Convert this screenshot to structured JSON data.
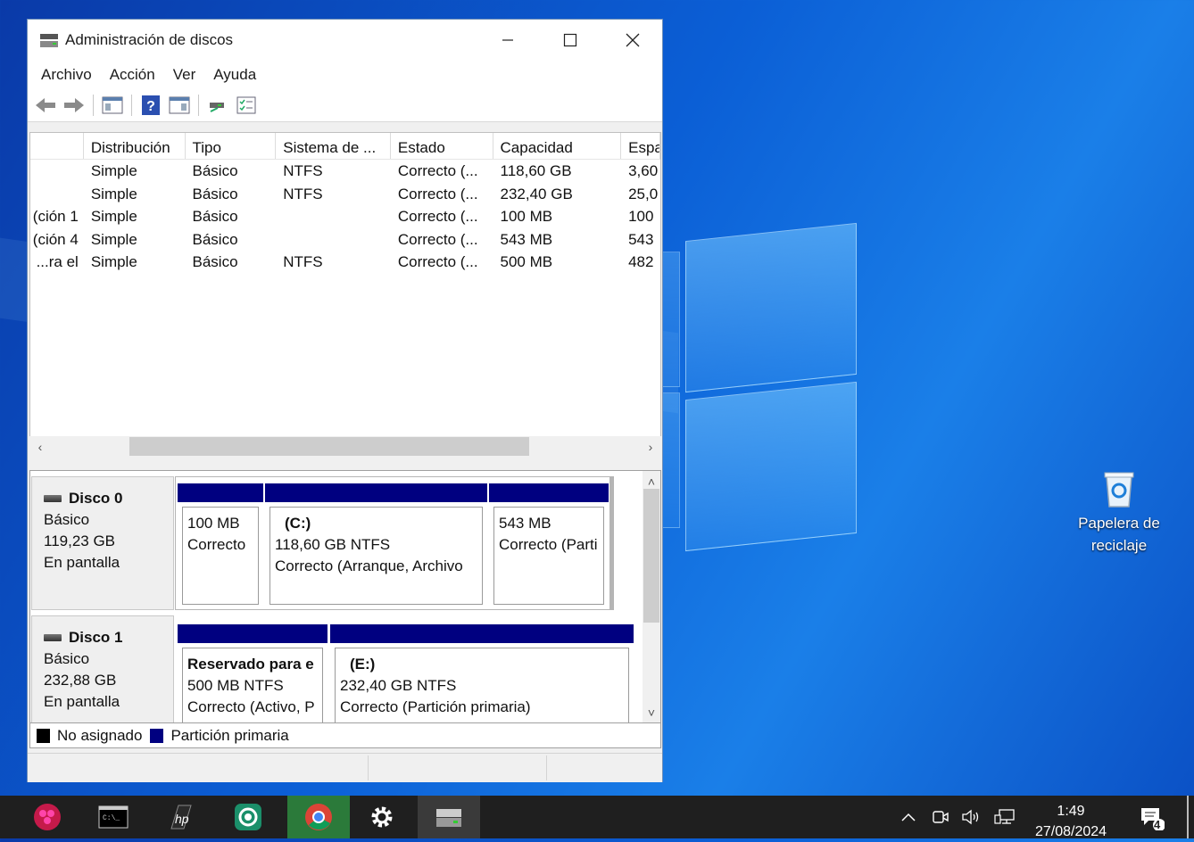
{
  "window": {
    "title": "Administración de discos",
    "menu": [
      "Archivo",
      "Acción",
      "Ver",
      "Ayuda"
    ]
  },
  "volume_list": {
    "columns": [
      "",
      "Distribución",
      "Tipo",
      "Sistema de ...",
      "Estado",
      "Capacidad",
      "Espa"
    ],
    "rows": [
      [
        "",
        "Simple",
        "Básico",
        "NTFS",
        "Correcto (...",
        "118,60 GB",
        "3,60"
      ],
      [
        "",
        "Simple",
        "Básico",
        "NTFS",
        "Correcto (...",
        "232,40 GB",
        "25,0"
      ],
      [
        "ción 1)",
        "Simple",
        "Básico",
        "",
        "Correcto (...",
        "100 MB",
        "100"
      ],
      [
        "ción 4)",
        "Simple",
        "Básico",
        "",
        "Correcto (...",
        "543 MB",
        "543"
      ],
      [
        "ra el...",
        "Simple",
        "Básico",
        "NTFS",
        "Correcto (...",
        "500 MB",
        "482"
      ]
    ]
  },
  "disks": [
    {
      "name": "Disco 0",
      "type": "Básico",
      "size": "119,23 GB",
      "status": "En pantalla",
      "partitions": [
        {
          "label": "",
          "size": "100 MB",
          "status": "Correcto"
        },
        {
          "label": "(C:)",
          "size": "118,60 GB NTFS",
          "status": "Correcto (Arranque, Archivo"
        },
        {
          "label": "",
          "size": "543 MB",
          "status": "Correcto (Parti"
        }
      ]
    },
    {
      "name": "Disco 1",
      "type": "Básico",
      "size": "232,88 GB",
      "status": "En pantalla",
      "partitions": [
        {
          "label": "Reservado para e",
          "size": "500 MB NTFS",
          "status": "Correcto (Activo, P"
        },
        {
          "label": "(E:)",
          "size": "232,40 GB NTFS",
          "status": "Correcto (Partición primaria)"
        }
      ]
    }
  ],
  "legend": {
    "unallocated": "No asignado",
    "primary": "Partición primaria"
  },
  "desktop": {
    "recycle_bin": "Papelera de reciclaje"
  },
  "taskbar": {
    "time": "1:49",
    "date": "27/08/2024",
    "notifications": "4"
  },
  "colors": {
    "primary_partition": "#000080",
    "unallocated": "#000000"
  }
}
